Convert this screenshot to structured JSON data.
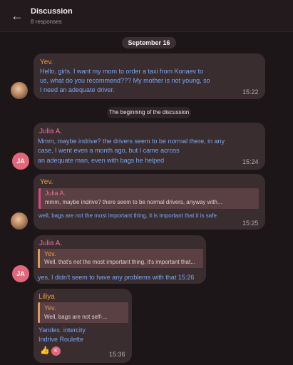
{
  "header": {
    "title": "Discussion",
    "subtitle": "8 responses",
    "back_icon": "arrow-left-icon"
  },
  "date_separator": "September 16",
  "discussion_start": "The beginning of the discussion",
  "messages": [
    {
      "author": "Yev.",
      "text_lines": [
        "Hello, girls. I want my mom to order a taxi from Konaev to",
        "us, what do you recommend??? My mother is not young, so",
        "I need an adequate driver."
      ],
      "time": "15:22"
    },
    {
      "author": "Julia A.",
      "avatar_initials": "JA",
      "text_lines": [
        "Mmm, maybe indrive? the drivers seem to be normal there, in any",
        "case, I went even a month ago, but I came across",
        "an adequate man, even with bags he helped"
      ],
      "time": "15:24"
    },
    {
      "author": "Yev.",
      "reply": {
        "author": "Julia A.",
        "text": "mmm, maybe indrive? there seem to be normal drivers, anyway with..."
      },
      "text_lines": [
        "well, bags are not the most important thing, it is important that it is safe"
      ],
      "time": "15:25"
    },
    {
      "author": "Julia A.",
      "avatar_initials": "JA",
      "reply": {
        "author": "Yev.",
        "text": "Well, that's not the most important thing, it's important that..."
      },
      "text_lines": [
        "yes, I didn't seem to have any problems with that 15:26"
      ],
      "time": ""
    },
    {
      "author": "Liliya",
      "reply": {
        "author": "Yev.",
        "text": "Well, bags are not self-..."
      },
      "text_lines": [
        "Yandex. intercity",
        "Indrive Roulette"
      ],
      "reaction": "👍",
      "reaction_user": "K",
      "time": "15:36"
    }
  ],
  "colors": {
    "background": "#1d1618",
    "bubble": "#3a2d30",
    "orange_name": "#e89a42",
    "pink_name": "#ec6b9a",
    "message_text": "#79a6f2"
  }
}
